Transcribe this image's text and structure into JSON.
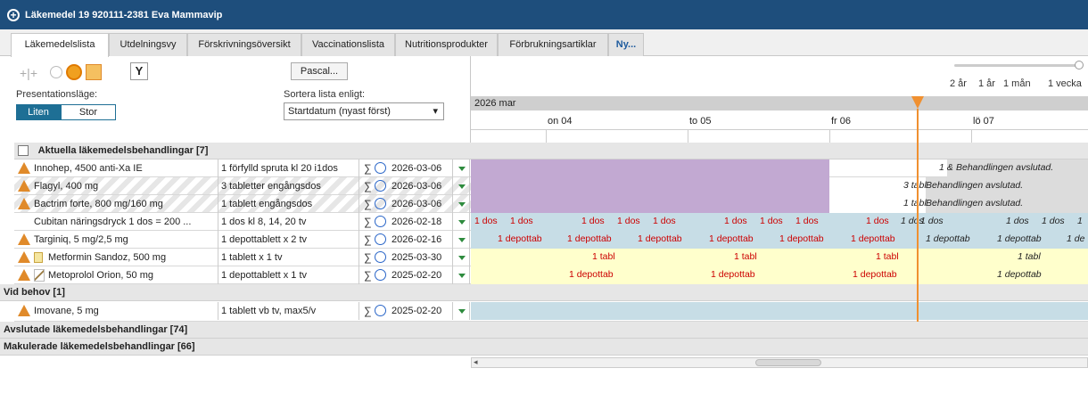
{
  "window": {
    "title": "Läkemedel 19 920111-2381 Eva Mammavip"
  },
  "tabs": [
    {
      "label": "Läkemedelslista",
      "active": true
    },
    {
      "label": "Utdelningsvy"
    },
    {
      "label": "Förskrivningsöversikt"
    },
    {
      "label": "Vaccinationslista"
    },
    {
      "label": "Nutritionsprodukter"
    },
    {
      "label": "Förbrukningsartiklar"
    },
    {
      "label": "Ny..."
    }
  ],
  "toolbar": {
    "pascal_label": "Pascal...",
    "presentation_label": "Presentationsläge:",
    "seg_small": "Liten",
    "seg_large": "Stor",
    "sort_label": "Sortera lista enligt:",
    "sort_value": "Startdatum (nyast först)"
  },
  "zoom": {
    "labels": [
      "2 år",
      "1 år",
      "1 mån",
      "1 vecka"
    ]
  },
  "timeline": {
    "month": "2026 mar",
    "days": [
      "on 04",
      "to 05",
      "fr 06",
      "lö 07"
    ]
  },
  "sections": {
    "current": "Aktuella läkemedelsbehandlingar [7]",
    "as_needed": "Vid behov [1]",
    "finished": "Avslutade läkemedelsbehandlingar [74]",
    "cancelled": "Makulerade läkemedelsbehandlingar [66]"
  },
  "rows": [
    {
      "name": "Innohep, 4500 anti-Xa IE",
      "dose": "1 förfylld spruta kl 20 i1dos",
      "date": "2026-03-06"
    },
    {
      "name": "Flagyl, 400 mg",
      "dose": "3 tabletter engångsdos",
      "date": "2026-03-06"
    },
    {
      "name": "Bactrim forte, 800 mg/160 mg",
      "dose": "1 tablett engångsdos",
      "date": "2026-03-06"
    },
    {
      "name": "Cubitan näringsdryck 1 dos = 200 ...",
      "dose": "1 dos kl 8, 14, 20 tv",
      "date": "2026-02-18"
    },
    {
      "name": "Targiniq, 5 mg/2,5 mg",
      "dose": "1 depottablett x 2 tv",
      "date": "2026-02-16"
    },
    {
      "name": "Metformin Sandoz, 500 mg",
      "dose": "1 tablett x 1 tv",
      "date": "2025-03-30"
    },
    {
      "name": "Metoprolol Orion, 50 mg",
      "dose": "1 depottablett x 1 tv",
      "date": "2025-02-20"
    },
    {
      "name": "Imovane, 5 mg",
      "dose": "1 tablett vb tv, max5/v",
      "date": "2025-02-20"
    }
  ],
  "events": {
    "ended": "Behandlingen avslutad.",
    "dos": "1 dos",
    "depottab": "1 depottab",
    "tabl": "1 tabl",
    "one": "1",
    "onede": "1 de",
    "tab1": "1 &",
    "tab3": "3 tabl",
    "tab1b": "1 tabl"
  },
  "colors": {
    "purple": "#c2a9d2",
    "blue": "#c7dde6",
    "yellow": "#ffffcc",
    "gray": "#dcdcdc",
    "accent": "#1e6f95",
    "now": "#f09030"
  }
}
